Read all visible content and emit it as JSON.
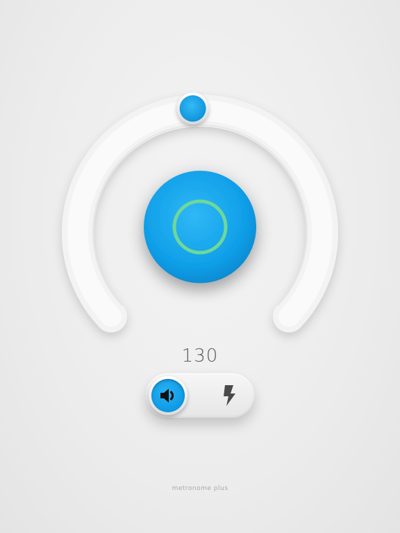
{
  "tempo": {
    "value": "130",
    "dial_fraction": 0.5
  },
  "play_button": {
    "state": "stopped",
    "ring_color": "#6ed89a",
    "fill_color": "#0f9fe8"
  },
  "mode_toggle": {
    "selected": "sound",
    "options": [
      {
        "id": "sound",
        "icon": "speaker-icon"
      },
      {
        "id": "flash",
        "icon": "flash-icon"
      }
    ]
  },
  "footer": {
    "app_name": "metronome plus"
  },
  "colors": {
    "accent_blue": "#0f9fe8",
    "ring_green": "#6ed89a",
    "icon_dark": "#3d3d3d",
    "icon_gray": "#4a4a4a"
  }
}
